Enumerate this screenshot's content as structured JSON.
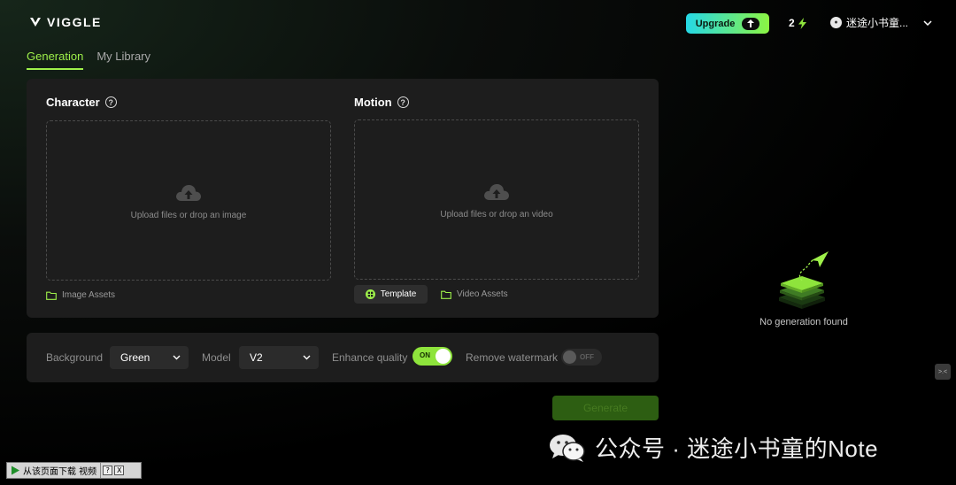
{
  "app": {
    "name": "VIGGLE"
  },
  "header": {
    "upgrade_label": "Upgrade",
    "credits": "2",
    "user_name": "迷途小书童..."
  },
  "tabs": [
    {
      "label": "Generation",
      "active": true
    },
    {
      "label": "My Library",
      "active": false
    }
  ],
  "character": {
    "title": "Character",
    "upload_text": "Upload files or drop an image",
    "assets_label": "Image Assets"
  },
  "motion": {
    "title": "Motion",
    "upload_text": "Upload files or drop an video",
    "template_label": "Template",
    "assets_label": "Video Assets"
  },
  "settings": {
    "background_label": "Background",
    "background_value": "Green",
    "model_label": "Model",
    "model_value": "V2",
    "enhance_label": "Enhance quality",
    "enhance_state": "ON",
    "watermark_label": "Remove watermark",
    "watermark_state": "OFF"
  },
  "generate_label": "Generate",
  "empty_state": {
    "text": "No generation found"
  },
  "overlay": {
    "watermark_text": "公众号 · 迷途小书童的Note",
    "download_bar_text": "从该页面下载 视频",
    "download_help": "?",
    "download_close": "X"
  },
  "colors": {
    "accent": "#9ef04a",
    "upgrade_gradient_start": "#25d8e6",
    "upgrade_gradient_end": "#8cf542",
    "panel": "#1d1d1d",
    "generate_disabled": "#2d5e12"
  },
  "icons": {
    "help": "help-circle-icon",
    "upload": "cloud-upload-icon",
    "folder": "folder-icon",
    "template": "template-icon",
    "chevron": "chevron-down-icon",
    "bolt": "lightning-bolt-icon"
  }
}
